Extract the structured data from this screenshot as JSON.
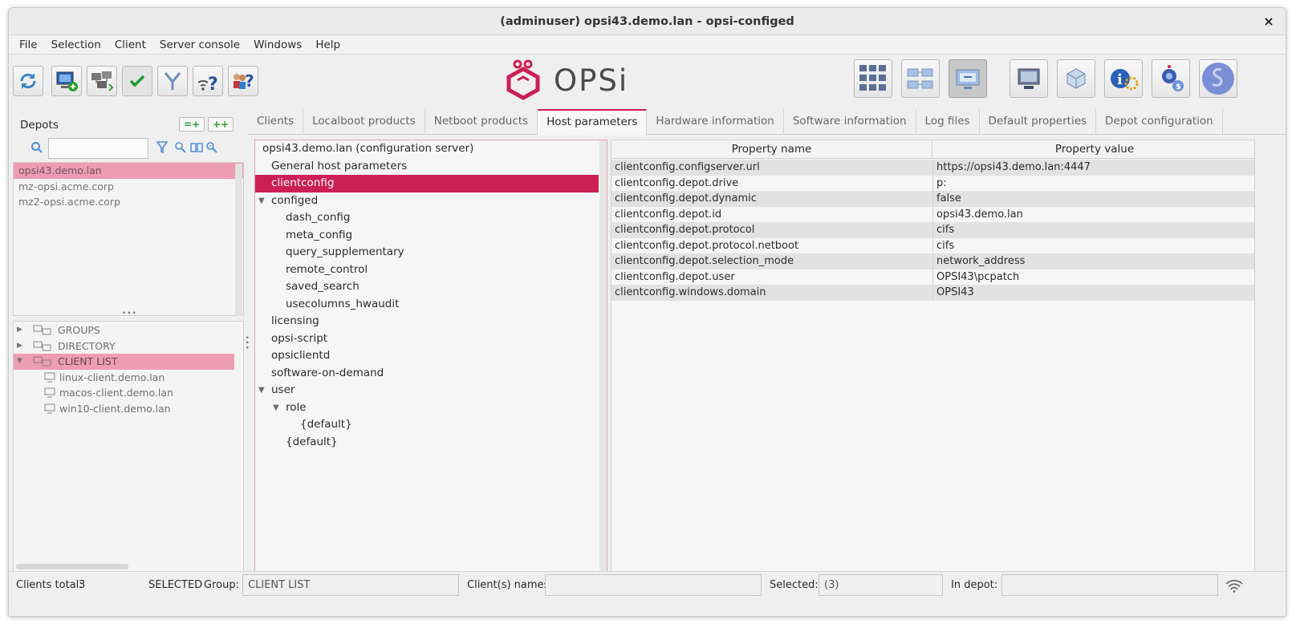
{
  "window": {
    "title": "(adminuser) opsi43.demo.lan - opsi-configed",
    "close_glyph": "×"
  },
  "menu": [
    "File",
    "Selection",
    "Client",
    "Server console",
    "Windows",
    "Help"
  ],
  "logo": {
    "text": "OPSi"
  },
  "toolbar_left": [
    {
      "name": "reload",
      "icon": "refresh-icon"
    },
    {
      "name": "new-client",
      "icon": "new-client-icon"
    },
    {
      "name": "clients-network",
      "icon": "network-clients-icon"
    },
    {
      "name": "save",
      "icon": "checkmark-icon"
    },
    {
      "name": "filter",
      "icon": "filter-icon"
    },
    {
      "name": "wake-help",
      "icon": "wifi-question-icon"
    },
    {
      "name": "session-help",
      "icon": "people-question-icon"
    }
  ],
  "toolbar_right": [
    {
      "name": "clients-grid",
      "icon": "clients-grid-icon",
      "active": false
    },
    {
      "name": "client-groups",
      "icon": "client-groups-icon",
      "active": false
    },
    {
      "name": "client-selection",
      "icon": "client-selection-icon",
      "active": true
    },
    {
      "name": "server-console",
      "icon": "server-console-icon",
      "active": false
    },
    {
      "name": "depot-config",
      "icon": "depot-cube-icon",
      "active": false
    },
    {
      "name": "info",
      "icon": "info-icon",
      "active": false
    },
    {
      "name": "licensing",
      "icon": "licensing-icon",
      "active": false
    },
    {
      "name": "opsi-script",
      "icon": "script-icon",
      "active": false
    }
  ],
  "depots": {
    "label": "Depots",
    "btn_add_one": "=+",
    "btn_add_all": "++",
    "search_value": "",
    "items": [
      {
        "label": "opsi43.demo.lan",
        "selected": true
      },
      {
        "label": "mz-opsi.acme.corp",
        "selected": false
      },
      {
        "label": "mz2-opsi.acme.corp",
        "selected": false
      }
    ]
  },
  "client_tree": [
    {
      "label": "GROUPS",
      "level": 0,
      "toggle": "▶",
      "selected": false
    },
    {
      "label": "DIRECTORY",
      "level": 0,
      "toggle": "▶",
      "selected": false
    },
    {
      "label": "CLIENT LIST",
      "level": 0,
      "toggle": "▼",
      "selected": true
    },
    {
      "label": "linux-client.demo.lan",
      "level": 1,
      "toggle": "",
      "selected": false
    },
    {
      "label": "macos-client.demo.lan",
      "level": 1,
      "toggle": "",
      "selected": false
    },
    {
      "label": "win10-client.demo.lan",
      "level": 1,
      "toggle": "",
      "selected": false
    }
  ],
  "tabs": [
    {
      "label": "Clients",
      "active": false
    },
    {
      "label": "Localboot products",
      "active": false
    },
    {
      "label": "Netboot products",
      "active": false
    },
    {
      "label": "Host parameters",
      "active": true
    },
    {
      "label": "Hardware information",
      "active": false
    },
    {
      "label": "Software information",
      "active": false
    },
    {
      "label": "Log files",
      "active": false
    },
    {
      "label": "Default properties",
      "active": false
    },
    {
      "label": "Depot configuration",
      "active": false
    }
  ],
  "host_tree": [
    {
      "label": "opsi43.demo.lan (configuration server)",
      "level": 0,
      "toggle": "",
      "selected": false
    },
    {
      "label": "General host parameters",
      "level": 1,
      "toggle": "",
      "selected": false
    },
    {
      "label": "clientconfig",
      "level": 1,
      "toggle": "",
      "selected": true
    },
    {
      "label": "configed",
      "level": 1,
      "toggle": "▼",
      "selected": false
    },
    {
      "label": "dash_config",
      "level": 2,
      "toggle": "",
      "selected": false
    },
    {
      "label": "meta_config",
      "level": 2,
      "toggle": "",
      "selected": false
    },
    {
      "label": "query_supplementary",
      "level": 2,
      "toggle": "",
      "selected": false
    },
    {
      "label": "remote_control",
      "level": 2,
      "toggle": "",
      "selected": false
    },
    {
      "label": "saved_search",
      "level": 2,
      "toggle": "",
      "selected": false
    },
    {
      "label": "usecolumns_hwaudit",
      "level": 2,
      "toggle": "",
      "selected": false
    },
    {
      "label": "licensing",
      "level": 1,
      "toggle": "",
      "selected": false
    },
    {
      "label": "opsi-script",
      "level": 1,
      "toggle": "",
      "selected": false
    },
    {
      "label": "opsiclientd",
      "level": 1,
      "toggle": "",
      "selected": false
    },
    {
      "label": "software-on-demand",
      "level": 1,
      "toggle": "",
      "selected": false
    },
    {
      "label": "user",
      "level": 1,
      "toggle": "▼",
      "selected": false
    },
    {
      "label": "role",
      "level": 2,
      "toggle": "▼",
      "selected": false
    },
    {
      "label": "{default}",
      "level": 3,
      "toggle": "",
      "selected": false
    },
    {
      "label": "{default}",
      "level": 2,
      "toggle": "",
      "selected": false
    }
  ],
  "properties": {
    "col_name": "Property name",
    "col_value": "Property value",
    "rows": [
      {
        "name": "clientconfig.configserver.url",
        "value": "https://opsi43.demo.lan:4447"
      },
      {
        "name": "clientconfig.depot.drive",
        "value": "p:"
      },
      {
        "name": "clientconfig.depot.dynamic",
        "value": "false"
      },
      {
        "name": "clientconfig.depot.id",
        "value": "opsi43.demo.lan"
      },
      {
        "name": "clientconfig.depot.protocol",
        "value": "cifs"
      },
      {
        "name": "clientconfig.depot.protocol.netboot",
        "value": "cifs"
      },
      {
        "name": "clientconfig.depot.selection_mode",
        "value": "network_address"
      },
      {
        "name": "clientconfig.depot.user",
        "value": "OPSI43\\pcpatch"
      },
      {
        "name": "clientconfig.windows.domain",
        "value": "OPSI43"
      }
    ]
  },
  "status": {
    "clients_total_label": "Clients total:",
    "clients_total_value": "3",
    "selected_tag": "SELECTED",
    "group_label": "Group:",
    "group_value": "CLIENT LIST",
    "client_names_label": "Client(s) names:",
    "client_names_value": "",
    "selected_label": "Selected:",
    "selected_value": "(3)",
    "in_depot_label": "In depot:",
    "in_depot_value": ""
  },
  "colors": {
    "accent": "#cc1f55",
    "selection_pink": "#ee9bb4",
    "green_btn": "#2f9f2f"
  }
}
